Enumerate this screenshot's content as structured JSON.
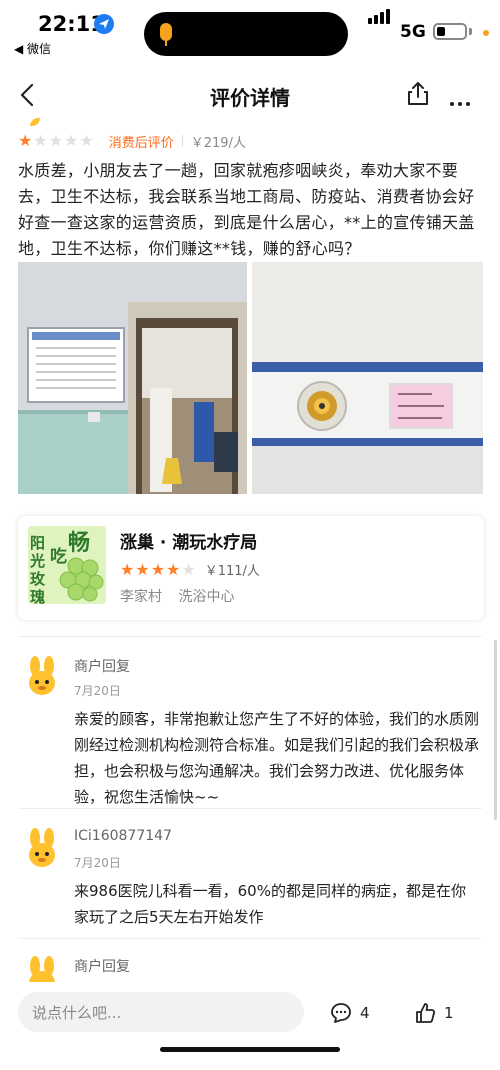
{
  "status_bar": {
    "time": "22:11",
    "back_app": "◀ 微信",
    "network": "5G"
  },
  "nav": {
    "title": "评价详情"
  },
  "review": {
    "stars": 1,
    "max_stars": 5,
    "tag": "消费后评价",
    "price": "￥219/人",
    "text": "水质差，小朋友去了一趟，回家就疱疹咽峡炎，奉劝大家不要去，卫生不达标，我会联系当地工商局、防疫站、消费者协会好好查一查这家的运营资质，到底是什么居心，**上的宣传铺天盖地，卫生不达标，你们赚这**钱，赚的舒心吗？"
  },
  "shop": {
    "image_text": "阳光玫瑰畅吃",
    "name": "涨巢 · 潮玩水疗局",
    "stars": 4,
    "price": "￥111/人",
    "area": "李家村",
    "category": "洗浴中心"
  },
  "comments": [
    {
      "name": "商户回复",
      "date": "7月20日",
      "body": "亲爱的顾客，非常抱歉让您产生了不好的体验，我们的水质刚刚经过检测机构检测符合标准。如是我们引起的我们会积极承担，也会积极与您沟通解决。我们会努力改进、优化服务体验，祝您生活愉快~~"
    },
    {
      "name": "ICi160877147",
      "date": "7月20日",
      "body": "来986医院儿科看一看，60%的都是同样的病症，都是在你家玩了之后5天左右开始发作"
    },
    {
      "name": "商户回复",
      "date": "",
      "body": ""
    }
  ],
  "bottom_bar": {
    "input_placeholder": "说点什么吧...",
    "comment_count": "4",
    "like_count": "1"
  },
  "colors": {
    "accent": "#ff6a1a",
    "star": "#ff7e2a",
    "mascot": "#ffc12d"
  }
}
